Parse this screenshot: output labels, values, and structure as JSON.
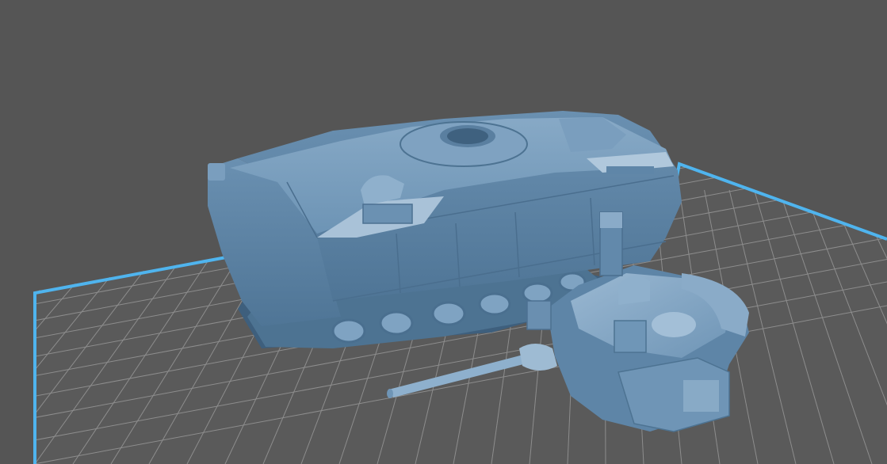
{
  "viewport": {
    "background_color": "#555555"
  },
  "build_plate": {
    "surface_color": "#5a5a5a",
    "grid_color": "#8d8d8d",
    "border_color": "#4fb4ee"
  },
  "models": [
    {
      "name": "tank-hull",
      "material_color": "#6d94b5"
    },
    {
      "name": "tank-turret",
      "material_color": "#6d94b5"
    },
    {
      "name": "tank-cannon",
      "material_color": "#8eb0cd"
    }
  ]
}
